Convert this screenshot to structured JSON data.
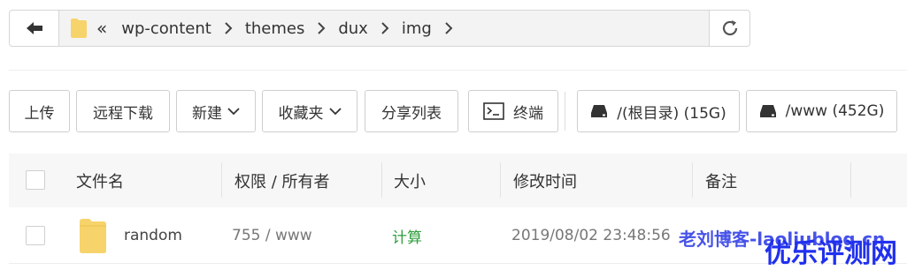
{
  "address_bar": {
    "crumbs": [
      "wp-content",
      "themes",
      "dux",
      "img"
    ]
  },
  "toolbar": {
    "upload": "上传",
    "remote_download": "远程下载",
    "new": "新建",
    "favorites": "收藏夹",
    "share_list": "分享列表",
    "terminal": "终端",
    "disk_root": "/(根目录) (15G)",
    "disk_www": "/www (452G)"
  },
  "table": {
    "headers": {
      "name": "文件名",
      "permission": "权限 / 所有者",
      "size": "大小",
      "modified": "修改时间",
      "note": "备注"
    },
    "rows": [
      {
        "name": "random",
        "permission": "755 / www",
        "size": "计算",
        "modified": "2019/08/02 23:48:56"
      }
    ]
  },
  "watermarks": {
    "text1": "老刘博客-laoliublog.cn",
    "text2": "优乐评测网"
  },
  "colors": {
    "folder": "#f7d36b",
    "size_link": "#2e9e3c",
    "watermark": "#2030ee"
  }
}
